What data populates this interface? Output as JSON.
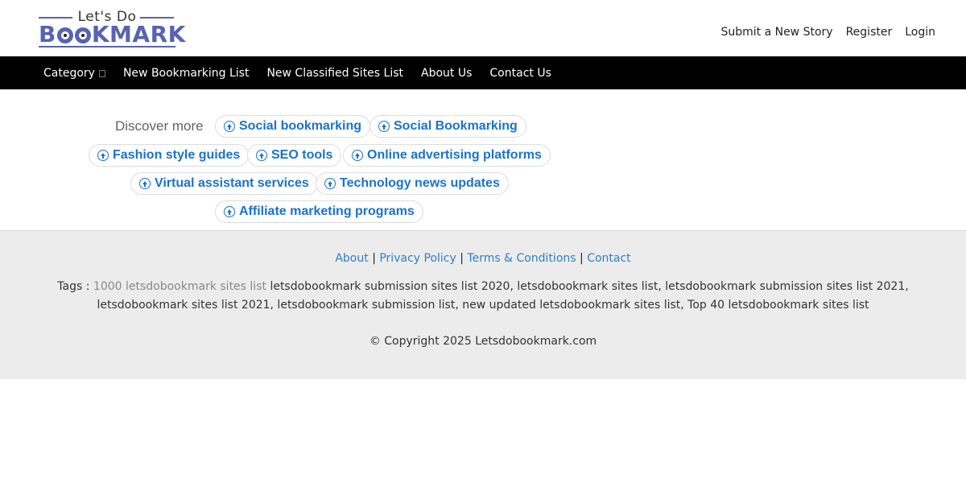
{
  "logo": {
    "small_text": "Let's Do",
    "big_text_pre": "B",
    "big_text_post": "KMARK"
  },
  "header": {
    "links": [
      "Submit a New Story",
      "Register",
      "Login"
    ]
  },
  "nav": {
    "category": "Category",
    "items": [
      "New Bookmarking List",
      "New Classified Sites List",
      "About Us",
      "Contact Us"
    ]
  },
  "discover": {
    "label": "Discover more",
    "chips": [
      "Social bookmarking",
      "Social Bookmarking",
      "Fashion style guides",
      "SEO tools",
      "Online advertising platforms",
      "Virtual assistant services",
      "Technology news updates",
      "Affiliate marketing programs"
    ]
  },
  "footer": {
    "links": [
      "About",
      "Privacy Policy",
      "Terms & Conditions",
      "Contact"
    ],
    "separator": "|",
    "tags_label": "Tags :",
    "tags_muted": "1000 letsdobookmark sites list",
    "tags_rest": "letsdobookmark submission sites list 2020, letsdobookmark sites list, letsdobookmark submission sites list 2021, letsdobookmark sites list 2021, letsdobookmark submission list, new updated letsdobookmark sites list, Top 40 letsdobookmark sites list",
    "copyright": "© Copyright 2025 Letsdobookmark.com"
  },
  "colors": {
    "accent": "#5863b0",
    "link": "#1a73c9",
    "nav_bg": "#000000",
    "footer_bg": "#ececec"
  }
}
